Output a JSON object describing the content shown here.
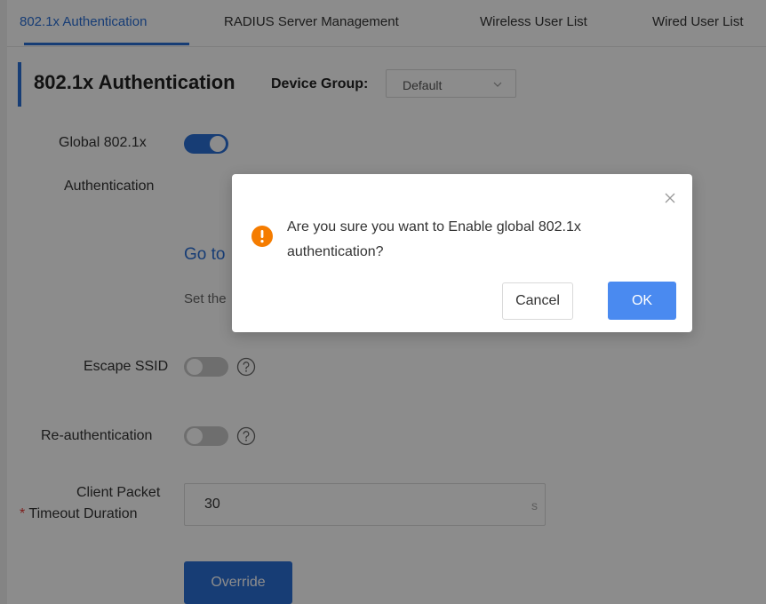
{
  "tabs": [
    {
      "label": "802.1x Authentication",
      "active": true
    },
    {
      "label": "RADIUS Server Management",
      "active": false
    },
    {
      "label": "Wireless User List",
      "active": false
    },
    {
      "label": "Wired User List",
      "active": false
    }
  ],
  "header": {
    "title": "802.1x Authentication",
    "device_group_label": "Device Group:",
    "device_group_value": "Default"
  },
  "form": {
    "global_label_line1": "Global 802.1x",
    "global_label_line2": "Authentication",
    "global_enabled": true,
    "go_to_text": "Go to",
    "set_text": "Set the",
    "escape_ssid_label": "Escape SSID",
    "escape_ssid_enabled": false,
    "reauth_label": "Re-authentication",
    "reauth_enabled": false,
    "timeout_label_line1": "Client Packet",
    "timeout_required_mark": "*",
    "timeout_label_line2": "Timeout Duration",
    "timeout_value": "30",
    "timeout_unit": "s",
    "override_label": "Override"
  },
  "modal": {
    "message": "Are you sure you want to Enable global 802.1x authentication?",
    "cancel_label": "Cancel",
    "ok_label": "OK"
  },
  "colors": {
    "accent": "#2b6fd6",
    "ok_button": "#4a8af0",
    "warning": "#f57c00",
    "required": "#e53935"
  },
  "icons": {
    "close": "close-icon",
    "warning": "warning-icon",
    "help": "help-icon",
    "chevron": "chevron-down-icon"
  }
}
